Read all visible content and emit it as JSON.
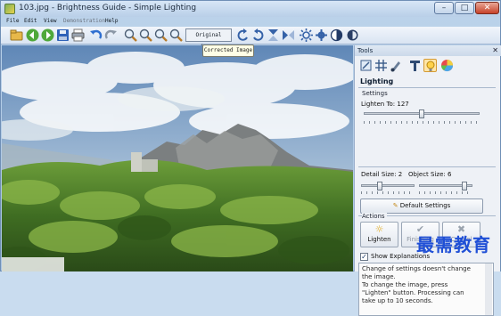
{
  "window": {
    "title": "103.jpg - Brightness Guide - Simple Lighting",
    "controls": {
      "minimize": "–",
      "maximize": "□",
      "close": "✕"
    }
  },
  "menu": {
    "items": [
      "File",
      "Edit",
      "View",
      "Demonstration",
      "Help"
    ]
  },
  "toolbar": {
    "original_image_label": "Original image",
    "tooltip": "Corrected Image",
    "icons": [
      "open-icon",
      "back-icon",
      "forward-icon",
      "save-icon",
      "print-icon",
      "undo-icon",
      "redo-icon",
      "zoom-in-icon",
      "zoom-out-icon",
      "zoom-fit-icon",
      "zoom-actual-icon",
      "rotate-left-icon",
      "rotate-right-icon",
      "flip-vertical-icon",
      "flip-horizontal-icon",
      "brightness-icon",
      "settings-icon",
      "contrast-icon",
      "help-icon"
    ]
  },
  "tools": {
    "header": "Tools",
    "close": "✕",
    "section_title": "Lighting",
    "settings_label": "Settings",
    "lighten_text": "Lighten To: 127",
    "lighten_value": 127,
    "lighten_max": 255,
    "detail_text": "Detail Size: 2",
    "object_text": "Object Size: 6",
    "default_settings_label": "Default Settings",
    "actions_label": "Actions",
    "actions": [
      {
        "label": "Lighten",
        "icon": "lighten-icon",
        "enabled": true
      },
      {
        "label": "Finishing",
        "icon": "check-icon",
        "enabled": false
      },
      {
        "label": "Cancel",
        "icon": "cancel-icon",
        "enabled": false
      }
    ],
    "show_explanations_label": "Show Explanations",
    "show_explanations_checked": true,
    "explanation_lines": [
      "Change of settings doesn't change",
      "the image.",
      "To change the image, press",
      "\"Lighten\" button. Processing can",
      "take up to 10 seconds."
    ]
  },
  "watermark": "最需教育",
  "colors": {
    "accent": "#2f6fd0",
    "watermark": "#1f4fd6"
  }
}
